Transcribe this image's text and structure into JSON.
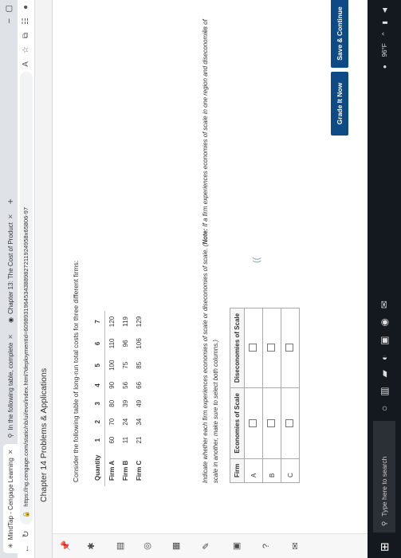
{
  "browser": {
    "tabs": [
      {
        "label": "MindTap - Cengage Learning",
        "active": true
      },
      {
        "label": "In the following table, complete",
        "active": false
      },
      {
        "label": "Chapter 13: The Cost of Product",
        "active": false
      }
    ],
    "new_tab_label": "+",
    "url": "https://ng.cengage.com/static/nb/ui/evo/index.html?deploymentId=60989319645343889827211924958x65806-97"
  },
  "app": {
    "title": "Chapter 14 Problems & Applications"
  },
  "prompt": "Consider the following table of long-run total costs for three different firms:",
  "cost_table": {
    "headers": [
      "Quantity",
      "1",
      "2",
      "3",
      "4",
      "5",
      "6",
      "7"
    ],
    "rows": [
      {
        "firm": "Firm A",
        "values": [
          "60",
          "70",
          "80",
          "90",
          "100",
          "110",
          "120"
        ]
      },
      {
        "firm": "Firm B",
        "values": [
          "11",
          "24",
          "39",
          "56",
          "75",
          "96",
          "119"
        ]
      },
      {
        "firm": "Firm C",
        "values": [
          "21",
          "34",
          "49",
          "66",
          "85",
          "106",
          "129"
        ]
      }
    ]
  },
  "instruction": {
    "text": "Indicate whether each firm experiences economies of scale or diseconomies of scale. (",
    "note_label": "Note:",
    "note_text": " If a firm experiences economies of scale in one region and diseconomies of scale in another, make sure to select both columns.)"
  },
  "econ_table": {
    "headers": [
      "Firm",
      "Economies of Scale",
      "Diseconomies of Scale"
    ],
    "rows": [
      {
        "firm": "A",
        "economies": false,
        "diseconomies": false
      },
      {
        "firm": "B",
        "economies": false,
        "diseconomies": false
      },
      {
        "firm": "C",
        "economies": false,
        "diseconomies": false
      }
    ]
  },
  "buttons": {
    "grade": "Grade It Now",
    "save": "Save & Continue"
  },
  "taskbar": {
    "search_placeholder": "Type here to search",
    "temperature": "96°F"
  }
}
